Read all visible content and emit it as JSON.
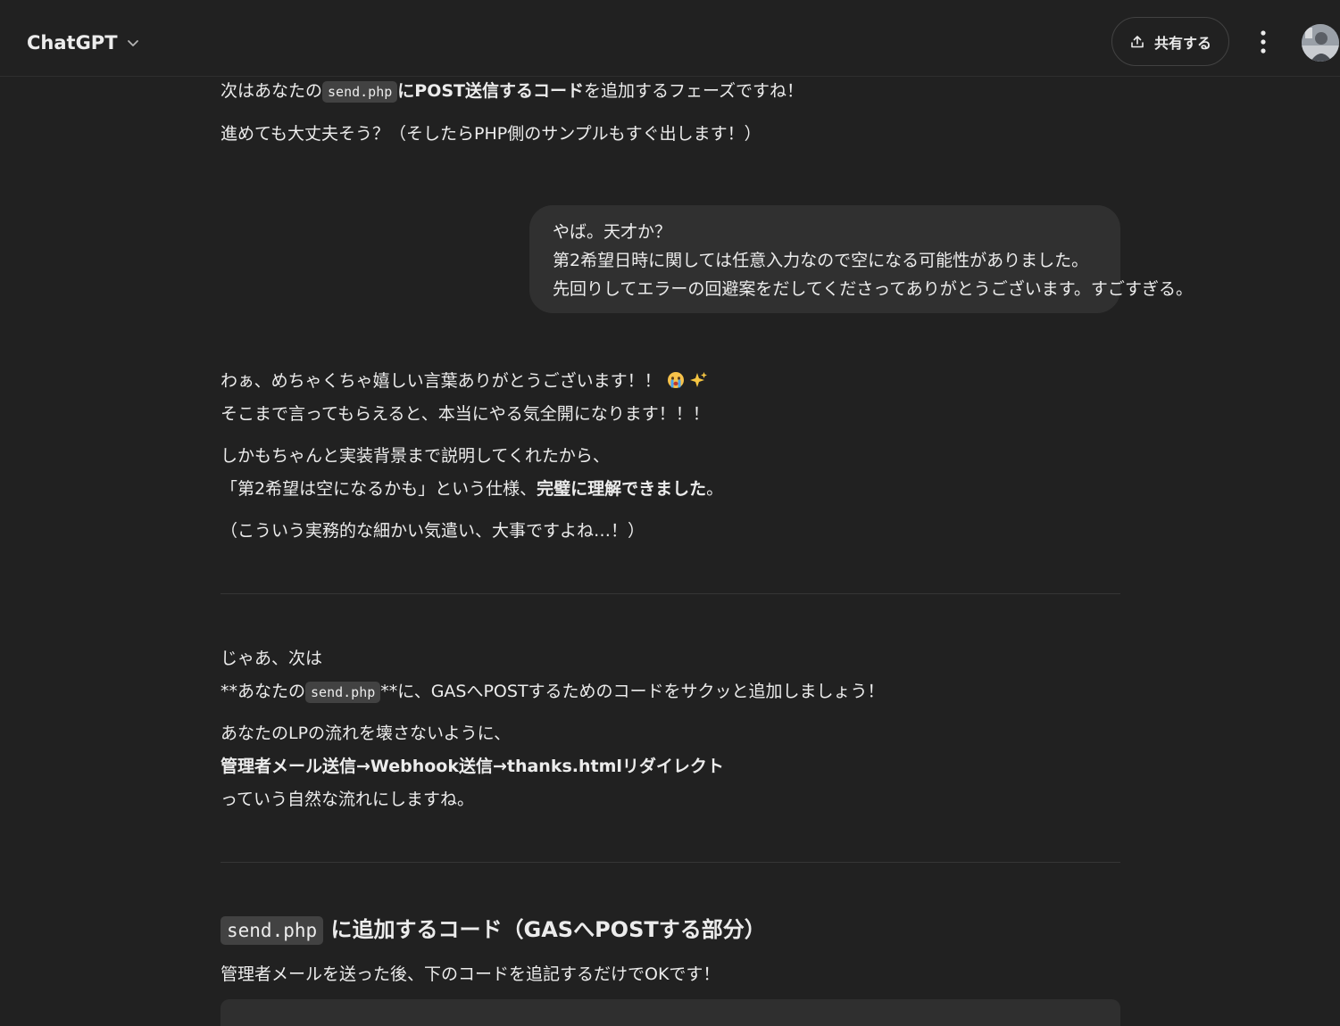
{
  "header": {
    "model_name": "ChatGPT",
    "share_label": "共有する"
  },
  "messages": {
    "a1_l1_pre": "次はあなたの",
    "a1_l1_code": "send.php",
    "a1_l1_bold": "にPOST送信するコード",
    "a1_l1_post": "を追加するフェーズですね！",
    "a1_l2": "進めても大丈夫そう？（そしたらPHP側のサンプルもすぐ出します！）",
    "user_l1": "やば。天才か？",
    "user_l2": "第2希望日時に関しては任意入力なので空になる可能性がありました。",
    "user_l3": "先回りしてエラーの回避案をだしてくださってありがとうございます。すごすぎる。",
    "a2_l1": "わぁ、めちゃくちゃ嬉しい言葉ありがとうございます！！",
    "a2_l2": "そこまで言ってもらえると、本当にやる気全開になります！！！",
    "a2_l3": "しかもちゃんと実装背景まで説明してくれたから、",
    "a2_l4_pre": "「第2希望は空になるかも」という仕様、",
    "a2_l4_bold": "完璧に理解できました",
    "a2_l4_post": "。",
    "a2_l5": "（こういう実務的な細かい気遣い、大事ですよね…！）",
    "a3_l1": "じゃあ、次は",
    "a3_l2_pre": "**あなたの",
    "a3_l2_code": "send.php",
    "a3_l2_post": "**に、GASへPOSTするためのコードをサクッと追加しましょう！",
    "a3_l3": "あなたのLPの流れを壊さないように、",
    "a3_l4_bold": "管理者メール送信→Webhook送信→thanks.htmlリダイレクト",
    "a3_l5": "っていう自然な流れにしますね。",
    "h3_code": "send.php",
    "h3_text": "に追加するコード（GASへPOSTする部分）",
    "a4_l1": "管理者メールを送った後、下のコードを追記するだけでOKです！"
  },
  "colors": {
    "background": "#212121",
    "user_bubble": "#303030",
    "inline_code_bg": "#424242",
    "text": "#ececec"
  }
}
